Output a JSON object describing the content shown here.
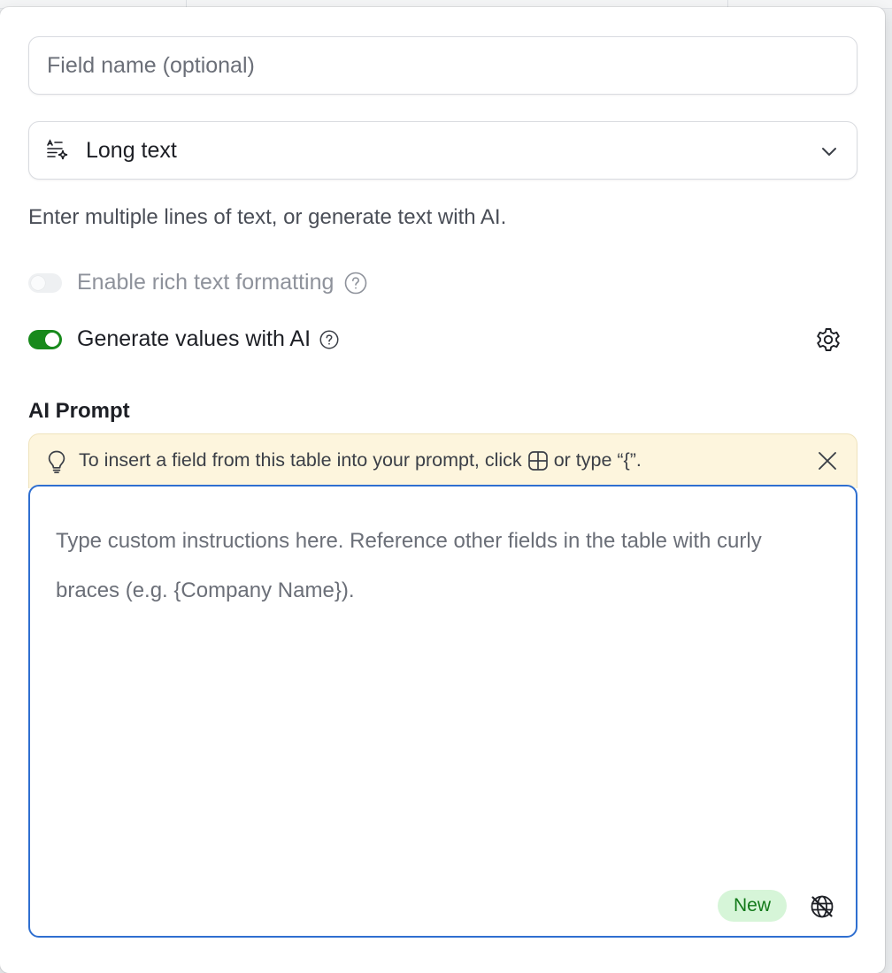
{
  "field_name": {
    "placeholder": "Field name (optional)",
    "value": ""
  },
  "field_type": {
    "label": "Long text",
    "icon": "long-text-ai-icon"
  },
  "description": "Enter multiple lines of text, or generate text with AI.",
  "rich_text": {
    "label": "Enable rich text formatting",
    "enabled": false,
    "disabled": true
  },
  "ai_generate": {
    "label": "Generate values with AI",
    "enabled": true
  },
  "ai_prompt": {
    "title": "AI Prompt",
    "hint_prefix": "To insert a field from this table into your prompt, click",
    "hint_suffix": "or type “{”.",
    "placeholder": "Type custom instructions here. Reference other fields in the table with curly braces (e.g. {Company Name}).",
    "badge": "New"
  },
  "colors": {
    "toggle_on": "#188a1c",
    "focus_border": "#2f6fd0",
    "hint_bg": "#fdf5dd",
    "badge_bg": "#d6f5d8",
    "badge_text": "#137a1a"
  }
}
